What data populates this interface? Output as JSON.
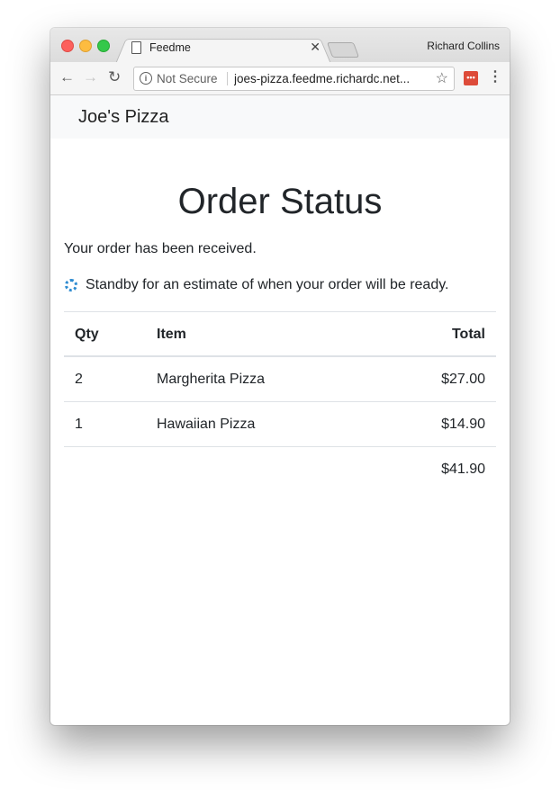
{
  "browser": {
    "tab_title": "Feedme",
    "profile_name": "Richard Collins",
    "security_label": "Not Secure",
    "url": "joes-pizza.feedme.richardc.net..."
  },
  "navbar": {
    "brand": "Joe's Pizza"
  },
  "page": {
    "title": "Order Status",
    "message": "Your order has been received.",
    "standby_message": "Standby for an estimate of when your order will be ready."
  },
  "order_table": {
    "headers": {
      "qty": "Qty",
      "item": "Item",
      "total": "Total"
    },
    "rows": [
      {
        "qty": "2",
        "item": "Margherita Pizza",
        "total": "$27.00"
      },
      {
        "qty": "1",
        "item": "Hawaiian Pizza",
        "total": "$14.90"
      }
    ],
    "grand_total": "$41.90"
  },
  "icons": {
    "spinner": "loading-spinner-icon",
    "extension": "lastpass-icon"
  },
  "colors": {
    "navbar_bg": "#f8f9fa",
    "spinner": "#2e8bd0",
    "text": "#212529"
  }
}
